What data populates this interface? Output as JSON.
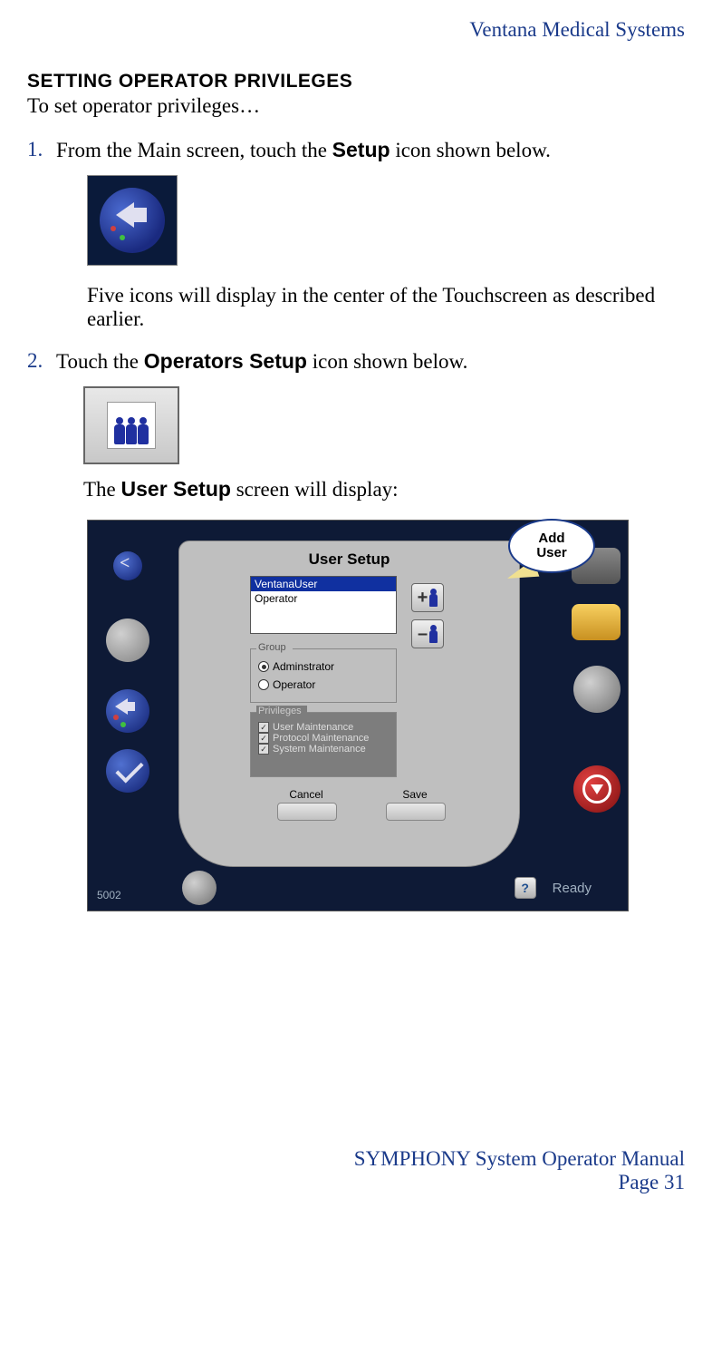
{
  "header": {
    "company": "Ventana Medical Systems"
  },
  "section": {
    "title": "SETTING OPERATOR PRIVILEGES",
    "intro": "To set operator privileges…"
  },
  "steps": {
    "s1": {
      "num": "1.",
      "text_before": "From the Main screen, touch the ",
      "bold": "Setup",
      "text_after": " icon shown below.",
      "followup": "Five icons will display in the center of the Touchscreen as described earlier."
    },
    "s2": {
      "num": "2.",
      "text_before": "Touch the ",
      "bold": "Operators Setup",
      "text_after": " icon shown below.",
      "lead_before": "The ",
      "lead_bold": "User Setup",
      "lead_after": " screen will display:"
    }
  },
  "screenshot": {
    "title": "User Setup",
    "users": [
      "VentanaUser",
      "Operator"
    ],
    "group": {
      "label": "Group",
      "opt1": "Adminstrator",
      "opt2": "Operator"
    },
    "priv": {
      "label": "Privileges",
      "p1": "User Maintenance",
      "p2": "Protocol Maintenance",
      "p3": "System Maintenance"
    },
    "cancel": "Cancel",
    "save": "Save",
    "plus": "+",
    "minus": "–",
    "help": "?",
    "ready": "Ready",
    "serial": "5002"
  },
  "callout": {
    "line1": "Add",
    "line2": "User"
  },
  "footer": {
    "manual": "SYMPHONY System Operator Manual",
    "page": "Page 31"
  }
}
